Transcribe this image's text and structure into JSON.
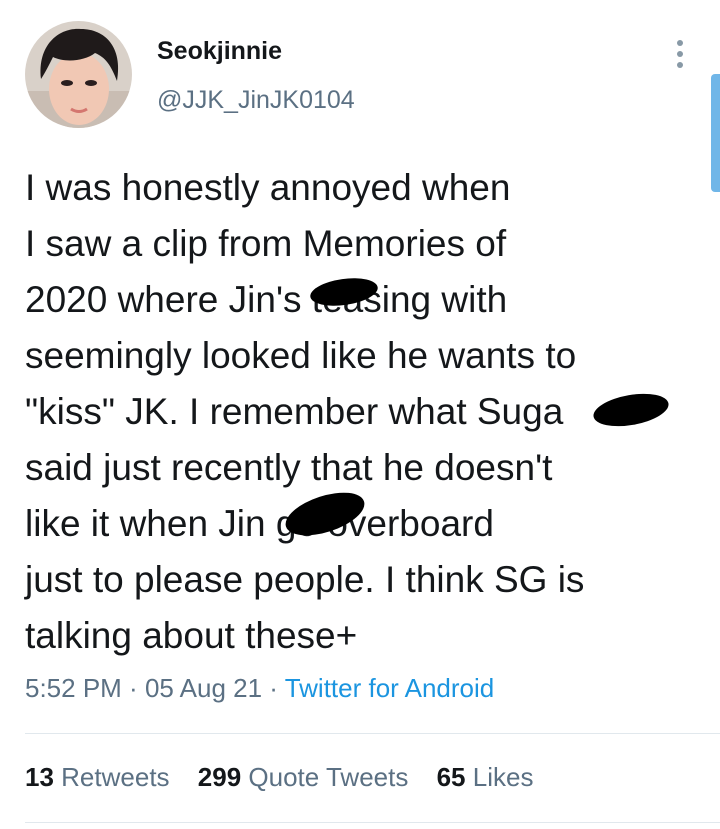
{
  "author": {
    "display_name": "Seokjinnie",
    "handle": "@JJK_JinJK0104"
  },
  "tweet": {
    "text": "I was honestly annoyed when\nI saw a clip from Memories of\n2020 where Jin's teasing with\nseemingly looked like he wants to\n\"kiss\" JK. I remember what Suga\nsaid just recently that he doesn't\nlike it when Jin go overboard\njust to please people. I think SG is\ntalking about these+"
  },
  "meta": {
    "time": "5:52 PM",
    "separator": " · ",
    "date": "05 Aug 21",
    "source": "Twitter for Android"
  },
  "stats": {
    "retweets": {
      "count": "13",
      "label": "Retweets"
    },
    "quote_tweets": {
      "count": "299",
      "label": "Quote Tweets"
    },
    "likes": {
      "count": "65",
      "label": "Likes"
    }
  },
  "icons": {
    "more": "more-vertical-icon"
  },
  "colors": {
    "text_primary": "#14171a",
    "text_secondary": "#5b7083",
    "link": "#1b95e0",
    "divider": "#e1e8ed",
    "scroll_thumb": "#70b6e8"
  }
}
